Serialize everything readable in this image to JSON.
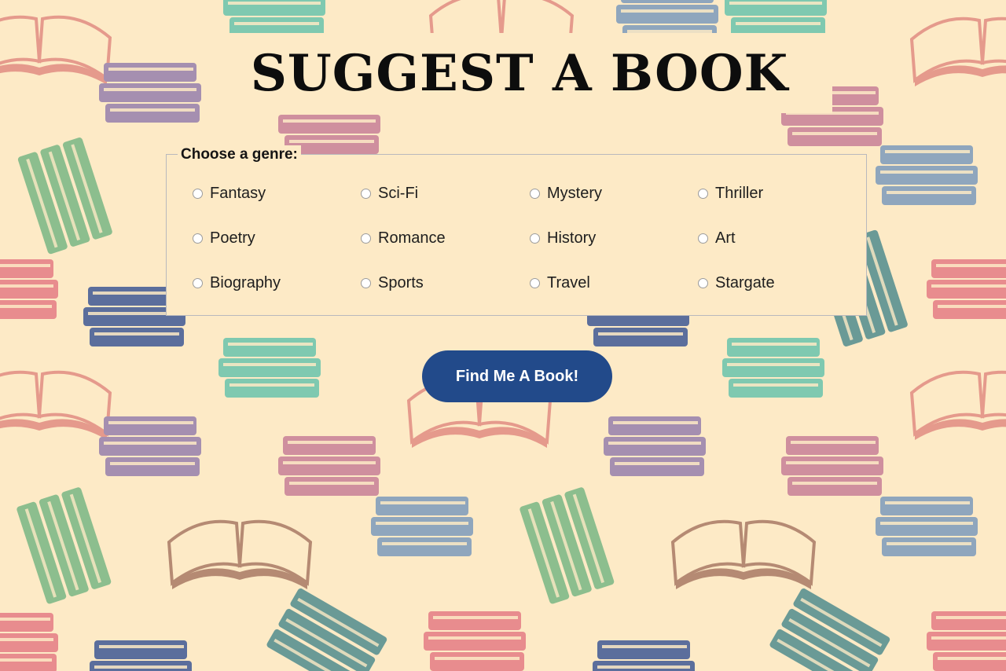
{
  "page": {
    "title": "SUGGEST A BOOK",
    "background_color": "#fdeac6"
  },
  "genre_form": {
    "legend": "Choose a genre:",
    "options": [
      {
        "label": "Fantasy",
        "selected": false
      },
      {
        "label": "Sci-Fi",
        "selected": false
      },
      {
        "label": "Mystery",
        "selected": false
      },
      {
        "label": "Thriller",
        "selected": false
      },
      {
        "label": "Poetry",
        "selected": false
      },
      {
        "label": "Romance",
        "selected": false
      },
      {
        "label": "History",
        "selected": false
      },
      {
        "label": "Art",
        "selected": false
      },
      {
        "label": "Biography",
        "selected": false
      },
      {
        "label": "Sports",
        "selected": false
      },
      {
        "label": "Travel",
        "selected": false
      },
      {
        "label": "Stargate",
        "selected": false
      }
    ]
  },
  "submit": {
    "label": "Find Me A Book!",
    "color": "#224a8a"
  },
  "decoration": {
    "pattern": "book-stacks-and-open-books",
    "palette": [
      "#a58fb0",
      "#cf8f9e",
      "#8fa6bd",
      "#7fc9b0",
      "#8cbe8e",
      "#e59a8c",
      "#5b6e9c",
      "#e88c8e",
      "#6a9a96",
      "#b58a73"
    ]
  }
}
